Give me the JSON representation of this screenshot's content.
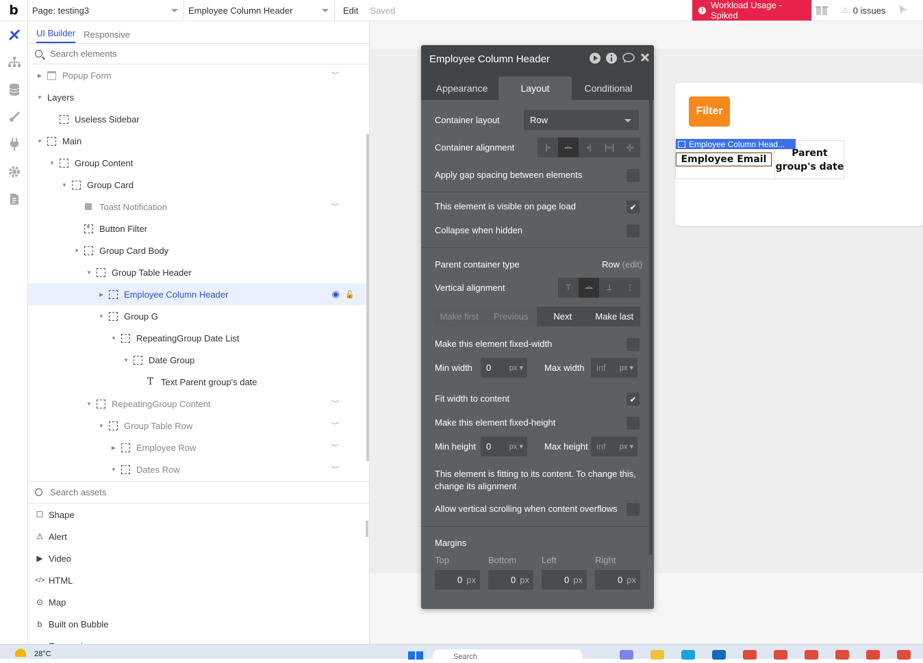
{
  "topbar": {
    "logo": "b",
    "page_select": "Page: testing3",
    "element_select": "Employee Column Header",
    "edit": "Edit",
    "saved": "Saved",
    "warning": "Workload Usage - Spiked",
    "issues": "0 issues"
  },
  "panel": {
    "tabs": [
      "UI Builder",
      "Responsive"
    ],
    "search_placeholder": "Search elements",
    "tree": [
      {
        "label": "Popup Form",
        "depth": 0,
        "arrow": "right",
        "icon": "popup",
        "hidden": true
      },
      {
        "label": "Layers",
        "depth": 0,
        "arrow": "down",
        "icon": "none",
        "hidden": false
      },
      {
        "label": "Useless Sidebar",
        "depth": 1,
        "arrow": "none",
        "icon": "group",
        "hidden": false
      },
      {
        "label": "Main",
        "depth": 0,
        "arrow": "down",
        "icon": "group",
        "hidden": false
      },
      {
        "label": "Group Content",
        "depth": 1,
        "arrow": "down",
        "icon": "group",
        "hidden": false
      },
      {
        "label": "Group Card",
        "depth": 2,
        "arrow": "down",
        "icon": "group",
        "hidden": false
      },
      {
        "label": "Toast Notification",
        "depth": 3,
        "arrow": "none",
        "icon": "solid",
        "hidden": true
      },
      {
        "label": "Button Filter",
        "depth": 3,
        "arrow": "none",
        "icon": "button",
        "hidden": false
      },
      {
        "label": "Group Card Body",
        "depth": 3,
        "arrow": "down",
        "icon": "group",
        "hidden": false
      },
      {
        "label": "Group Table Header",
        "depth": 4,
        "arrow": "down",
        "icon": "group",
        "hidden": false
      },
      {
        "label": "Employee Column Header",
        "depth": 5,
        "arrow": "right",
        "icon": "group",
        "hidden": false,
        "selected": true
      },
      {
        "label": "Group G",
        "depth": 5,
        "arrow": "down",
        "icon": "group",
        "hidden": false
      },
      {
        "label": "RepeatingGroup Date List",
        "depth": 6,
        "arrow": "down",
        "icon": "rg",
        "hidden": false
      },
      {
        "label": "Date Group",
        "depth": 7,
        "arrow": "down",
        "icon": "group",
        "hidden": false
      },
      {
        "label": "Text Parent group's date",
        "depth": 8,
        "arrow": "none",
        "icon": "text",
        "hidden": false
      },
      {
        "label": "RepeatingGroup Content",
        "depth": 4,
        "arrow": "down",
        "icon": "rg",
        "hidden": true
      },
      {
        "label": "Group Table Row",
        "depth": 5,
        "arrow": "down",
        "icon": "group",
        "hidden": true
      },
      {
        "label": "Employee Row",
        "depth": 6,
        "arrow": "right",
        "icon": "group",
        "hidden": true
      },
      {
        "label": "Dates Row",
        "depth": 6,
        "arrow": "down",
        "icon": "group",
        "hidden": true
      }
    ],
    "assets_placeholder": "Search assets",
    "assets": [
      {
        "label": "Shape",
        "icon": "square-icon"
      },
      {
        "label": "Alert",
        "icon": "alert-icon"
      },
      {
        "label": "Video",
        "icon": "video-icon"
      },
      {
        "label": "HTML",
        "icon": "code-icon"
      },
      {
        "label": "Map",
        "icon": "map-pin-icon"
      },
      {
        "label": "Built on Bubble",
        "icon": "bubble-logo-icon"
      },
      {
        "label": "Expression",
        "icon": "plus-icon"
      }
    ]
  },
  "canvas": {
    "filter_button": "Filter",
    "selected_label": "Employee Column Head...",
    "employee_email": "Employee Email",
    "parent_date": "Parent group's date"
  },
  "props": {
    "title": "Employee Column Header",
    "tabs": [
      "Appearance",
      "Layout",
      "Conditional"
    ],
    "container_layout_label": "Container layout",
    "container_layout_value": "Row",
    "container_alignment_label": "Container alignment",
    "gap_label": "Apply gap spacing between elements",
    "visible_label": "This element is visible on page load",
    "collapse_label": "Collapse when hidden",
    "parent_type_label": "Parent container type",
    "parent_type_value": "Row",
    "parent_type_edit": "(edit)",
    "vertical_alignment_label": "Vertical alignment",
    "nav": [
      "Make first",
      "Previous",
      "Next",
      "Make last"
    ],
    "fixed_width_label": "Make this element fixed-width",
    "min_width_label": "Min width",
    "min_width_value": "0",
    "max_width_label": "Max width",
    "max_width_placeholder": "inf",
    "unit": "px",
    "fit_width_label": "Fit width to content",
    "fixed_height_label": "Make this element fixed-height",
    "min_height_label": "Min height",
    "min_height_value": "0",
    "max_height_label": "Max height",
    "max_height_placeholder": "inf",
    "fitting_note": "This element is fitting to its content. To change this, change its alignment",
    "vscroll_label": "Allow vertical scrolling when content overflows",
    "margins_label": "Margins",
    "margin_names": [
      "Top",
      "Bottom",
      "Left",
      "Right"
    ],
    "margin_values": [
      "0",
      "0",
      "0",
      "0"
    ]
  },
  "taskbar": {
    "temp": "28°C",
    "search": "Search"
  }
}
